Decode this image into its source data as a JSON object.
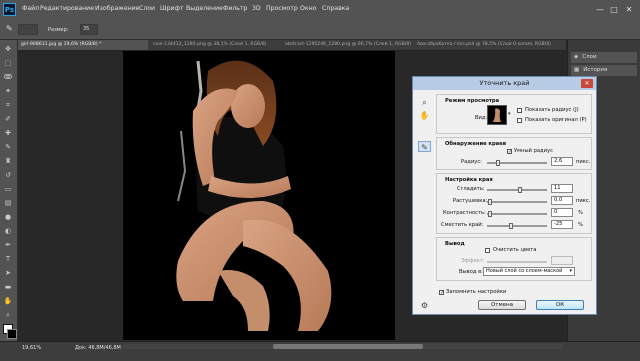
{
  "app": {
    "logo": "Ps"
  },
  "menu": [
    "Файл",
    "Редактирование",
    "Изображение",
    "Слои",
    "Шрифт",
    "Выделение",
    "Фильтр",
    "3D",
    "Просмотр",
    "Окно",
    "Справка"
  ],
  "window_controls": {
    "minimize": "—",
    "maximize": "□",
    "close": "✕"
  },
  "options_bar": {
    "size_label": "Размер:",
    "size_value": "35"
  },
  "doc_tabs": [
    "girl-908611.jpg @ 19,6% (RGB/8) *",
    "cool-134412_1280.png @ 38,1% (Слой 1, RGB/8)",
    "abstract-1295246_1280.png @ 66,7% (Слой 1, RGB/8)",
    "Ава-обработка глаз.psd @ 78,5% (Слой 0 копия, RGB/8)"
  ],
  "right_panels": {
    "paths": "Слои",
    "history": "История"
  },
  "status": {
    "zoom": "19,61%",
    "doc_size": "Док: 46,8M/46,8M"
  },
  "dialog": {
    "title": "Уточнить край",
    "close": "✕",
    "view_mode": {
      "title": "Режим просмотра",
      "view_label": "Вид:",
      "show_radius": "Показать радиус (J)",
      "show_original": "Показать оригинал (P)"
    },
    "edge_detection": {
      "title": "Обнаружение краев",
      "smart_radius": "Умный радиус",
      "radius_label": "Радиус:",
      "radius_value": "2,6",
      "radius_unit": "пикс.",
      "radius_level": 0.14
    },
    "adjust_edge": {
      "title": "Настройка края",
      "smooth_label": "Сгладить:",
      "smooth_value": "11",
      "smooth_level": 0.55,
      "feather_label": "Растушевка:",
      "feather_value": "0,0",
      "feather_unit": "пикс.",
      "feather_level": 0.0,
      "contrast_label": "Контрастность:",
      "contrast_value": "0",
      "contrast_unit": "%",
      "contrast_level": 0.0,
      "shift_label": "Сместить край:",
      "shift_value": "-25",
      "shift_unit": "%",
      "shift_level": 0.38
    },
    "output": {
      "title": "Вывод",
      "decontaminate": "Очистить цвета",
      "amount_label": "Эффект:",
      "output_to_label": "Вывод в:",
      "output_to_value": "Новый слой со слоем-маской"
    },
    "remember": "Запомнить настройки",
    "cancel": "Отмена",
    "ok": "ОК"
  }
}
